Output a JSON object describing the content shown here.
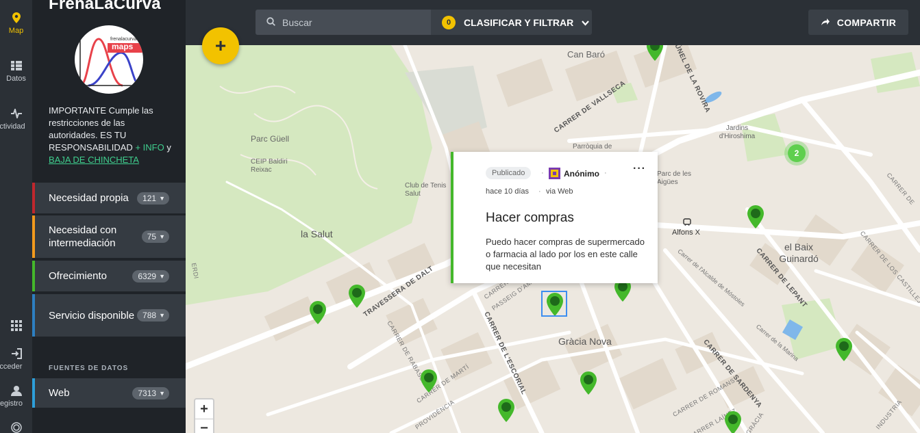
{
  "rail": {
    "items": [
      {
        "label": "Map",
        "icon": "map-pin-icon"
      },
      {
        "label": "Datos",
        "icon": "list-icon"
      },
      {
        "label": "Actividad",
        "icon": "activity-icon"
      },
      {
        "label": "",
        "icon": "apps-grid-icon"
      },
      {
        "label": "Acceder",
        "icon": "login-icon"
      },
      {
        "label": "Registro",
        "icon": "user-icon"
      }
    ],
    "active_color": "#f2c200"
  },
  "sidebar": {
    "brand": "FrenaLaCurva",
    "logo": {
      "small": "frenalacurva",
      "big": "maps"
    },
    "notice": {
      "text": "IMPORTANTE Cumple las restricciones de las autoridades. ES TU RESPONSABILIDAD",
      "info_link": "+ INFO",
      "conj": "y",
      "unpin_link": "BAJA DE CHINCHETA"
    },
    "categories": [
      {
        "label": "Necesidad propia",
        "count": "121",
        "color": "#c0272d"
      },
      {
        "label": "Necesidad con intermediación",
        "count": "75",
        "color": "#f29a1d"
      },
      {
        "label": "Ofrecimiento",
        "count": "6329",
        "color": "#44b82b"
      },
      {
        "label": "Servicio disponible",
        "count": "788",
        "color": "#2d7fc1"
      }
    ],
    "sources_title": "FUENTES DE DATOS",
    "sources": [
      {
        "label": "Web",
        "count": "7313",
        "color": "#2d9fd9"
      }
    ]
  },
  "topbar": {
    "search_placeholder": "Buscar",
    "filter_count": "0",
    "filter_label": "CLASIFICAR Y FILTRAR",
    "share_label": "COMPARTIR"
  },
  "map": {
    "places": {
      "can_baro": "Can Baró",
      "parc_guell": "Parc Güell",
      "ceip": "CEIP Baldiri Reixac",
      "club": "Club de Tenis Salut",
      "la_salut": "la Salut",
      "parroquia": "Parròquia de",
      "parc_aigues": "Parc de les Aigües",
      "jardins": "Jardins d'Hiroshima",
      "alfons": "Alfons X",
      "baix": "el Baix Guinardó",
      "gracia": "Gràcia Nova"
    },
    "streets": {
      "vallseca": "CARRER DE VALLSECA",
      "rovira": "TÚNEL DE LA ROVIRA",
      "dalt": "TRAVESSERA DE DALT",
      "escorial": "CARRER DE L'ESCORIAL",
      "rabassa": "CARRER DE RABASSA",
      "marti": "CARRER DE MARTÍ",
      "amunt": "PASSEIG D'AMUNT",
      "ba": "CARRER DE BA",
      "lepant": "CARRER DE LEPANT",
      "sardenya": "CARRER DE SARDENYA",
      "romans": "CARRER DE ROMANS",
      "lainez": "CARRER LAÍNEZ",
      "castillejos": "CARRER DE LOS CASTILLEJOS",
      "cartagena": "CARRER DE",
      "alcalde": "Carrer de l'Alcalde de Móstoles",
      "marina": "Carrer de la Marina",
      "providencia": "PROVIDÈNCIA",
      "gracia_st": "GRÀCIA",
      "industria": "INDUSTRIA",
      "erdi": "ERDI"
    },
    "cluster_count": "2",
    "pin_color": "#44b82b",
    "zoom_in": "+",
    "zoom_out": "−"
  },
  "fab_label": "+",
  "popup": {
    "status": "Publicado",
    "author": "Anónimo",
    "time": "hace 10 días",
    "via": "via Web",
    "title": "Hacer compras",
    "description": "Puedo hacer compras de supermercado o farmacia al lado por los en este calle que necesitan",
    "more": "···"
  }
}
